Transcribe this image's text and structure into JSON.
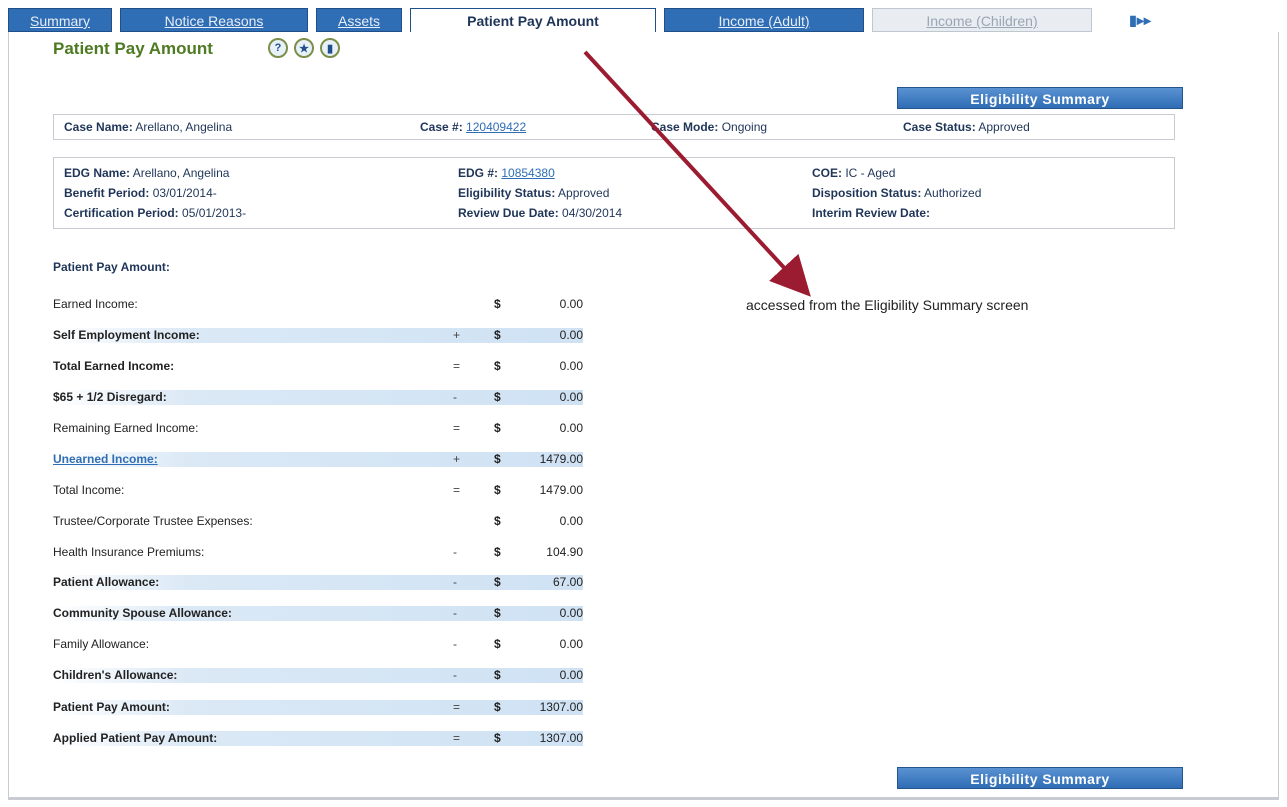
{
  "tabs": [
    {
      "label": "Summary"
    },
    {
      "label": "Notice Reasons"
    },
    {
      "label": "Assets"
    },
    {
      "label": "Patient Pay Amount"
    },
    {
      "label": "Income (Adult)"
    },
    {
      "label": "Income (Children)"
    },
    {
      "label": "▮▸▸"
    }
  ],
  "page": {
    "title": "Patient Pay Amount",
    "icons": [
      "help-icon",
      "favorite-icon",
      "notes-icon"
    ],
    "eligibility_button_label": "Eligibility Summary"
  },
  "case_info": {
    "case_name_label": "Case Name:",
    "case_name": "Arellano, Angelina",
    "case_no_label": "Case #:",
    "case_no": "120409422",
    "case_mode_label": "Case Mode:",
    "case_mode": "Ongoing",
    "case_status_label": "Case Status:",
    "case_status": "Approved"
  },
  "edg_info": {
    "edg_name_label": "EDG Name:",
    "edg_name": "Arellano, Angelina",
    "edg_no_label": "EDG #:",
    "edg_no": "10854380",
    "coe_label": "COE:",
    "coe": "IC - Aged",
    "benefit_period_label": "Benefit Period:",
    "benefit_period": "03/01/2014-",
    "eligibility_status_label": "Eligibility Status:",
    "eligibility_status": "Approved",
    "disposition_status_label": "Disposition Status:",
    "disposition_status": "Authorized",
    "certification_period_label": "Certification Period:",
    "certification_period": "05/01/2013-",
    "review_due_label": "Review Due Date:",
    "review_due": "04/30/2014",
    "interim_review_label": "Interim Review Date:",
    "interim_review": ""
  },
  "ppa": {
    "section_title": "Patient Pay Amount:",
    "currency": "$",
    "rows": [
      {
        "label": "Earned Income:",
        "op": "",
        "amount": "0.00"
      },
      {
        "label": "Self Employment Income:",
        "op": "+",
        "amount": "0.00"
      },
      {
        "label": "Total Earned Income:",
        "op": "=",
        "amount": "0.00"
      },
      {
        "label": "$65 + 1/2 Disregard:",
        "op": "-",
        "amount": "0.00"
      },
      {
        "label": "Remaining Earned Income:",
        "op": "=",
        "amount": "0.00"
      },
      {
        "label": "Unearned Income:",
        "op": "+",
        "amount": "1479.00"
      },
      {
        "label": "Total Income:",
        "op": "=",
        "amount": "1479.00"
      },
      {
        "label": "Trustee/Corporate Trustee Expenses:",
        "op": "",
        "amount": "0.00"
      },
      {
        "label": "Health Insurance Premiums:",
        "op": "-",
        "amount": "104.90"
      },
      {
        "label": "Patient Allowance:",
        "op": "-",
        "amount": "67.00"
      },
      {
        "label": "Community Spouse Allowance:",
        "op": "-",
        "amount": "0.00"
      },
      {
        "label": "Family Allowance:",
        "op": "-",
        "amount": "0.00"
      },
      {
        "label": "Children's Allowance:",
        "op": "-",
        "amount": "0.00"
      },
      {
        "label": "Patient Pay Amount:",
        "op": "=",
        "amount": "1307.00"
      },
      {
        "label": "Applied Patient Pay Amount:",
        "op": "=",
        "amount": "1307.00"
      }
    ]
  },
  "annotation": {
    "text": "accessed from the Eligibility Summary screen",
    "arrow_color": "#9b1b30"
  }
}
